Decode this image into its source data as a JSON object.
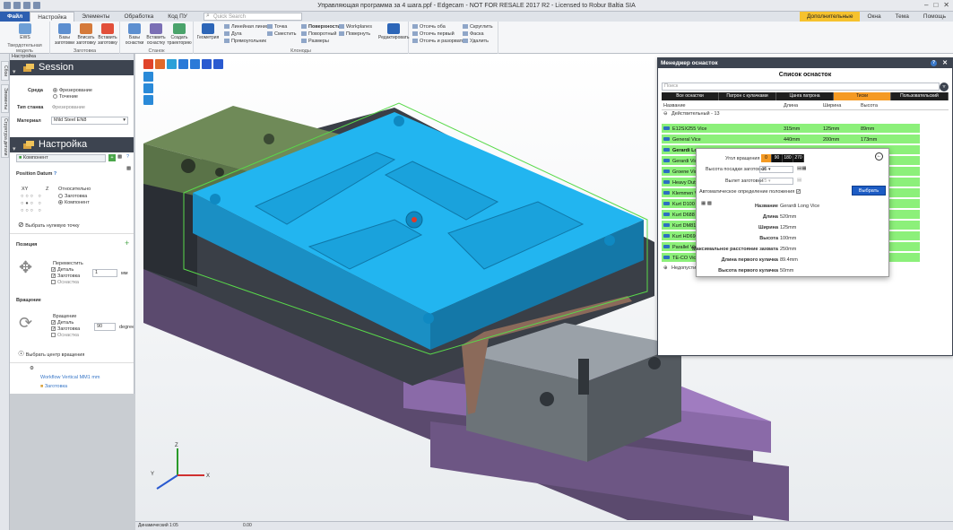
{
  "app": {
    "title": "Управляющая программа за 4 шага.ppf - Edgecam - NOT FOR RESALE 2017 R2 - Licensed to Robur Baltia SIA"
  },
  "tabs": {
    "file": "Файл",
    "items": [
      "Настройка",
      "Элементы",
      "Обработка",
      "Код ПУ"
    ],
    "search_placeholder": "Quick Search",
    "right": [
      "Дополнительные",
      "Окна",
      "Тема",
      "Помощь"
    ]
  },
  "ribbon": {
    "groups": [
      {
        "label": "Твердотельная модель",
        "buttons": [
          "EWS"
        ]
      },
      {
        "label": "Заготовка",
        "buttons": [
          "Базы заготовки",
          "Вписать заготовку",
          "Вставить заготовку"
        ]
      },
      {
        "label": "Станок",
        "buttons": [
          "Базы оснастки",
          "Вставить оснастку",
          "Создать траекторию"
        ]
      },
      {
        "label": "Клоноды",
        "buttons": [
          "Геометрия"
        ],
        "small": [
          "Линейная линия",
          "Дуга",
          "Прямоугольник",
          "Точка",
          "Сместить",
          "Поверхности",
          "Поворотный",
          "Размеры",
          "Workplanes",
          "Повернуть",
          "Редактировать"
        ]
      },
      {
        "label": "",
        "small": [
          "Отсечь оба",
          "Отсечь первый",
          "Отсечь и разорвать",
          "Скруглить",
          "Фаска",
          "Удалить"
        ]
      }
    ]
  },
  "left_panel": {
    "header": "Настройка",
    "session": {
      "title": "Session",
      "env_label": "Среда",
      "env_options": [
        "Фрезерование",
        "Точение"
      ],
      "stock_type_label": "Тип станка",
      "stock_type_value": "Фрезерование",
      "material_label": "Материал",
      "material_value": "Mild Steel EN8"
    },
    "setup": {
      "title": "Настройка",
      "component_value": "Компонент",
      "position_datum": "Position Datum",
      "axes": [
        "XY",
        "Z"
      ],
      "relative_label": "Относительно",
      "relative_options": [
        "Заготовка",
        "Компонент"
      ],
      "choose_zero": "Выбрать нулевую точку",
      "position_label": "Позиция",
      "move_label": "Переместить",
      "move_checks": [
        "Деталь",
        "Заготовка",
        "Оснастка"
      ],
      "move_value": "1",
      "move_unit": "мм",
      "rotation_label": "Вращение",
      "rotation_sub": "Вращение",
      "rotation_checks": [
        "Деталь",
        "Заготовка",
        "Оснастка"
      ],
      "rotation_value": "90",
      "rotation_unit": "degrees",
      "choose_center": "Выбрать центр вращения",
      "workflow_item": "Workflow Vertical MM1 mm",
      "stock_item": "Заготовка"
    }
  },
  "vtabs": [
    "Сбои",
    "Элементы",
    "Структура детали"
  ],
  "status": {
    "mode": "Динамический 1:05",
    "value": "0.00"
  },
  "dialog": {
    "title": "Менеджер оснасток",
    "subtitle": "Список оснасток",
    "search_placeholder": "Поиск",
    "categories": [
      "Все оснастки",
      "Патрон с кулачками",
      "Цанга патрона",
      "Тиски",
      "Пользовательский"
    ],
    "active_category": 3,
    "columns": [
      "Название",
      "Длина",
      "Ширина",
      "Высота"
    ],
    "group_valid": "Действительный - 13",
    "group_invalid": "Недопустимый",
    "rows": [
      {
        "name": "E12SX255 Vice",
        "length": "315mm",
        "width": "125mm",
        "height": "89mm"
      },
      {
        "name": "General Vice",
        "length": "440mm",
        "width": "200mm",
        "height": "173mm"
      },
      {
        "name": "Gerardi Long Vice",
        "length": "520mm",
        "width": "125mm",
        "height": "100mm"
      },
      {
        "name": "Gerardi Vice",
        "length": "",
        "width": "",
        "height": ""
      },
      {
        "name": "Groene Vice",
        "length": "",
        "width": "",
        "height": ""
      },
      {
        "name": "Heavy Duty",
        "length": "",
        "width": "",
        "height": ""
      },
      {
        "name": "Klemmen V",
        "length": "",
        "width": "",
        "height": ""
      },
      {
        "name": "Kurt D100 V",
        "length": "",
        "width": "",
        "height": ""
      },
      {
        "name": "Kurt D688 V",
        "length": "",
        "width": "",
        "height": ""
      },
      {
        "name": "Kurt DM810",
        "length": "",
        "width": "",
        "height": ""
      },
      {
        "name": "Kurt HD690",
        "length": "",
        "width": "",
        "height": ""
      },
      {
        "name": "Parallel Vice",
        "length": "",
        "width": "",
        "height": ""
      },
      {
        "name": "TE-CO Vice",
        "length": "",
        "width": "",
        "height": ""
      }
    ]
  },
  "popup": {
    "angle_label": "Угол вращения",
    "angles": [
      "0",
      "90",
      "180",
      "270"
    ],
    "height_label": "Высота посадки заготовки",
    "height_value": "35",
    "overhang_label": "Вылет заготовки",
    "overhang_value": "25",
    "auto_label": "Автоматическое определение положения",
    "select_button": "Выбрать",
    "props": [
      {
        "k": "Название",
        "v": "Gerardi Long Vice"
      },
      {
        "k": "Длина",
        "v": "520mm"
      },
      {
        "k": "Ширина",
        "v": "125mm"
      },
      {
        "k": "Высота",
        "v": "100mm"
      },
      {
        "k": "Максимальное расстояние захвата",
        "v": "250mm"
      },
      {
        "k": "Длина первого кулачка",
        "v": "89.4mm"
      },
      {
        "k": "Высота первого кулачка",
        "v": "50mm"
      }
    ]
  },
  "colors": {
    "accent": "#f59a23",
    "row_green": "#8cf07a",
    "part_blue": "#22b5f0",
    "fixture_purple": "#a07cc0",
    "dark_header": "#3d4450",
    "select_blue": "#1d5cc4"
  }
}
